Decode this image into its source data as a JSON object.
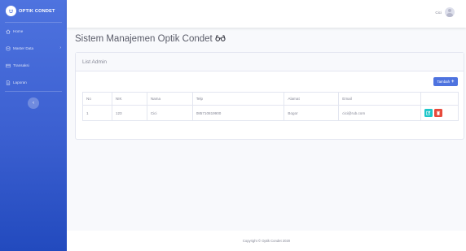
{
  "brand": {
    "name": "OPTIK CONDET"
  },
  "sidebar": {
    "items": [
      {
        "label": "Home",
        "icon": "home-icon"
      },
      {
        "label": "Master Data",
        "icon": "database-icon",
        "arrow": "›"
      },
      {
        "label": "Transaksi",
        "icon": "exchange-icon"
      },
      {
        "label": "Laporan",
        "icon": "report-icon"
      }
    ],
    "toggle_icon": "‹"
  },
  "topbar": {
    "user_name": "Cici"
  },
  "page": {
    "title": "Sistem Manajemen Optik Condet"
  },
  "card": {
    "header": "List Admin",
    "add_button": "Tambah",
    "add_icon": "+"
  },
  "table": {
    "columns": [
      "No",
      "NIK",
      "Nama",
      "Telp",
      "Alamat",
      "Email",
      ""
    ],
    "rows": [
      {
        "no": "1",
        "nik": "123",
        "nama": "Cici",
        "telp": "085710819900",
        "alamat": "Bogor",
        "email": "cici@rub.com"
      }
    ]
  },
  "footer": {
    "text": "Copyright © Optik Condet 2020"
  },
  "colors": {
    "primary": "#4e73df",
    "info": "#1cc6c9",
    "danger": "#e74a3b"
  }
}
